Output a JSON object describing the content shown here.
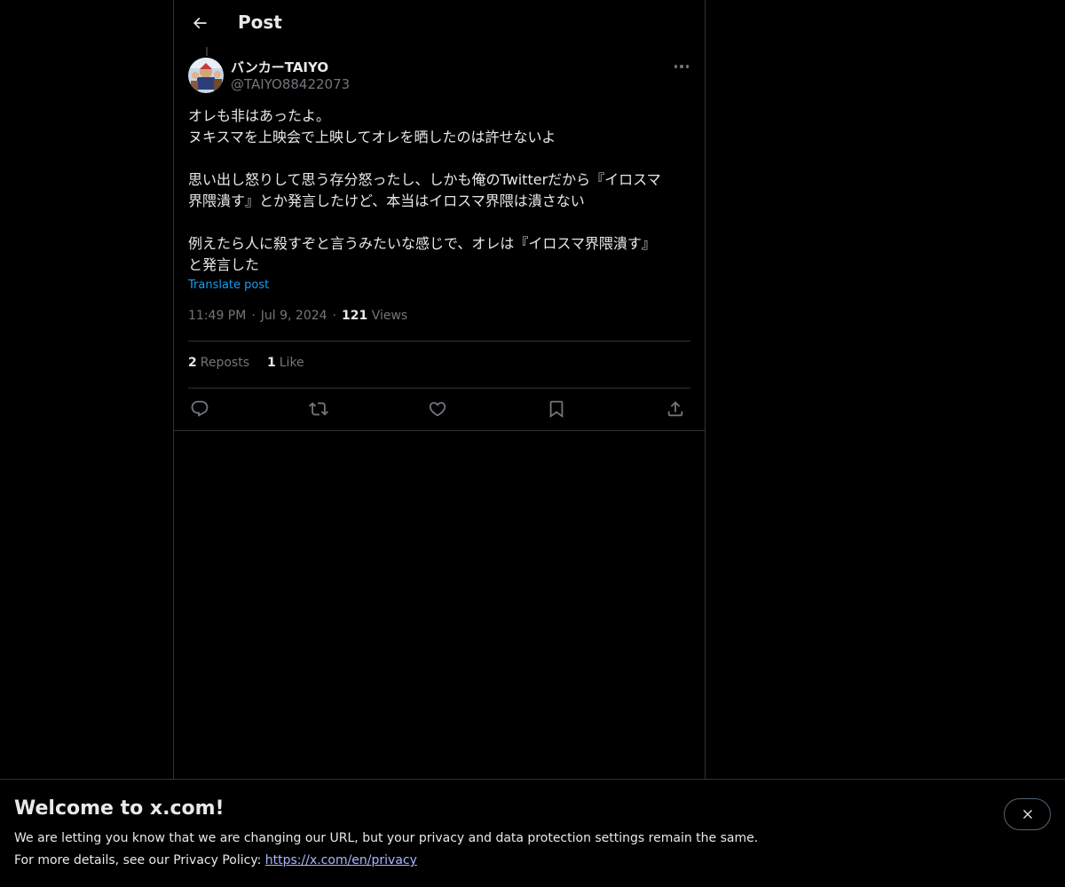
{
  "header": {
    "title": "Post"
  },
  "author": {
    "display_name": "バンカーTAIYO",
    "handle": "@TAIYO88422073"
  },
  "post": {
    "lines": [
      "オレも非はあったよ。",
      "ヌキスマを上映会で上映してオレを晒したのは許せないよ",
      "",
      "思い出し怒りして思う存分怒ったし、しかも俺のTwitterだから『イロスマ",
      "界隈潰す』とか発言したけど、本当はイロスマ界隈は潰さない",
      "",
      "例えたら人に殺すぞと言うみたいな感じで、オレは『イロスマ界隈潰す』",
      "と発言した"
    ],
    "translate_label": "Translate post",
    "time": "11:49 PM",
    "date": "Jul 9, 2024",
    "views_count": "121",
    "views_label": "Views"
  },
  "stats": {
    "reposts_count": "2",
    "reposts_label": "Reposts",
    "likes_count": "1",
    "likes_label": "Like"
  },
  "banner": {
    "title": "Welcome to x.com!",
    "line1": "We are letting you know that we are changing our URL, but your privacy and data protection settings remain the same.",
    "line2_prefix": "For more details, see our Privacy Policy: ",
    "link": "https://x.com/en/privacy"
  },
  "colors": {
    "accent": "#1d9bf0",
    "link": "#a6b8ff",
    "muted": "#71767b",
    "border": "#2f3336"
  }
}
